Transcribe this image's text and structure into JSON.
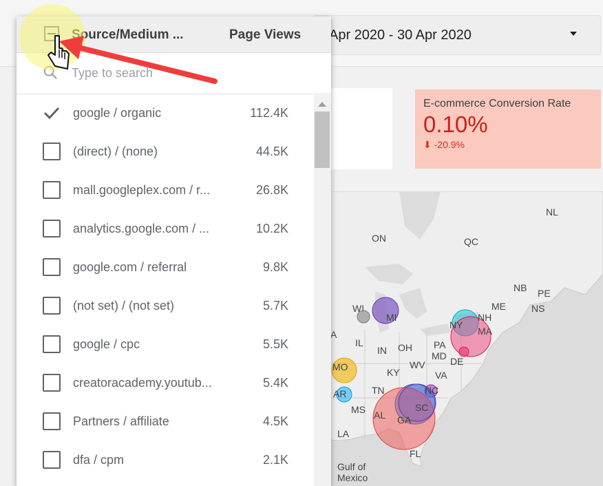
{
  "date_range": {
    "value": "Apr 2020 - 30 Apr 2020"
  },
  "scorecard": {
    "label": "E-commerce Conversion Rate",
    "value": "0.10%",
    "delta": "-20.9%",
    "accent": "#c5221f",
    "background": "#fbc9bd"
  },
  "map": {
    "labels": {
      "NL": "NL",
      "ON": "ON",
      "QC": "QC",
      "NB": "NB",
      "PE": "PE",
      "NS": "NS",
      "ME": "ME",
      "NH": "NH",
      "NY": "NY",
      "MA": "MA",
      "WI": "WI",
      "MI": "MI",
      "IL": "IL",
      "IN": "IN",
      "OH": "OH",
      "PA": "PA",
      "MD": "MD",
      "DE": "DE",
      "WV": "WV",
      "VA": "VA",
      "KY": "KY",
      "MO": "MO",
      "TN": "TN",
      "NC": "NC",
      "AR": "AR",
      "SC": "SC",
      "MS": "MS",
      "AL": "AL",
      "GA": "GA",
      "LA": "LA",
      "FL": "FL",
      "A": "A"
    },
    "gulf_label_1": "Gulf of",
    "gulf_label_2": "Mexico"
  },
  "dropdown": {
    "header_dimension": "Source/Medium ...",
    "header_metric": "Page Views",
    "search_placeholder": "Type to search",
    "items": [
      {
        "label": "google / organic",
        "value": "112.4K",
        "checked": true
      },
      {
        "label": "(direct) / (none)",
        "value": "44.5K",
        "checked": false
      },
      {
        "label": "mall.googleplex.com / r...",
        "value": "26.8K",
        "checked": false
      },
      {
        "label": "analytics.google.com / ...",
        "value": "10.2K",
        "checked": false
      },
      {
        "label": "google.com / referral",
        "value": "9.8K",
        "checked": false
      },
      {
        "label": "(not set) / (not set)",
        "value": "5.7K",
        "checked": false
      },
      {
        "label": "google / cpc",
        "value": "5.5K",
        "checked": false
      },
      {
        "label": "creatoracademy.youtub...",
        "value": "5.4K",
        "checked": false
      },
      {
        "label": "Partners / affiliate",
        "value": "4.5K",
        "checked": false
      },
      {
        "label": "dfa / cpm",
        "value": "2.1K",
        "checked": false
      }
    ]
  },
  "annotation": {
    "arrow_color": "#ef3d3d",
    "highlight_color": "#f8f578"
  }
}
